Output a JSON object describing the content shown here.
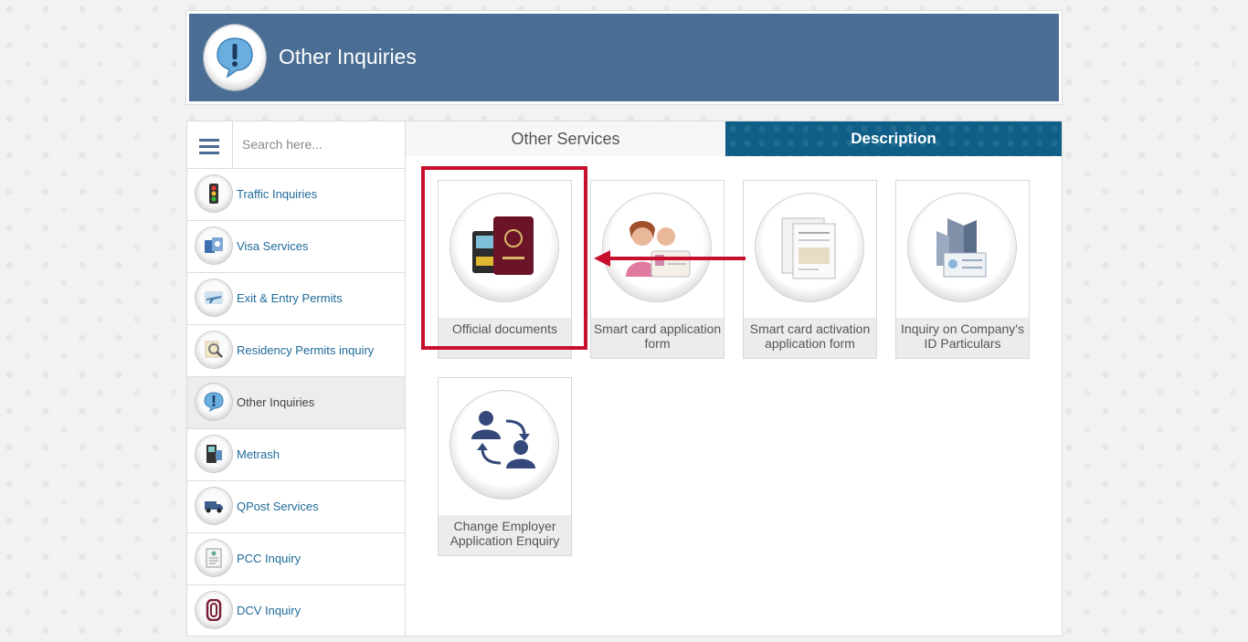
{
  "header": {
    "title": "Other Inquiries",
    "icon": "exclamation-speech-bubble-icon"
  },
  "search": {
    "placeholder": "Search here..."
  },
  "sidebar": {
    "items": [
      {
        "label": "Traffic Inquiries",
        "icon": "traffic-light-icon"
      },
      {
        "label": "Visa Services",
        "icon": "passports-icon"
      },
      {
        "label": "Exit & Entry Permits",
        "icon": "airplane-icon"
      },
      {
        "label": "Residency Permits inquiry",
        "icon": "magnifier-document-icon"
      },
      {
        "label": "Other Inquiries",
        "icon": "exclamation-bubble-icon",
        "active": true
      },
      {
        "label": "Metrash",
        "icon": "metrash-kiosk-icon"
      },
      {
        "label": "QPost Services",
        "icon": "delivery-truck-icon"
      },
      {
        "label": "PCC Inquiry",
        "icon": "certificate-icon"
      },
      {
        "label": "DCV Inquiry",
        "icon": "dcv-logo-icon"
      }
    ]
  },
  "tabs": {
    "other": "Other Services",
    "description": "Description"
  },
  "services": [
    {
      "label": "Official documents",
      "icon": "passport-kiosk-icon"
    },
    {
      "label": "Smart card application form",
      "icon": "people-id-card-icon"
    },
    {
      "label": "Smart card activation application form",
      "icon": "forms-documents-icon"
    },
    {
      "label": "Inquiry on Company's ID Particulars",
      "icon": "company-building-icon"
    },
    {
      "label": "Change Employer Application Enquiry",
      "icon": "change-employer-icon"
    }
  ],
  "colors": {
    "header_bg": "#4a6d94",
    "tab_active_bg": "#0f5f88",
    "link": "#1f6a99",
    "highlight": "#c8102e"
  }
}
